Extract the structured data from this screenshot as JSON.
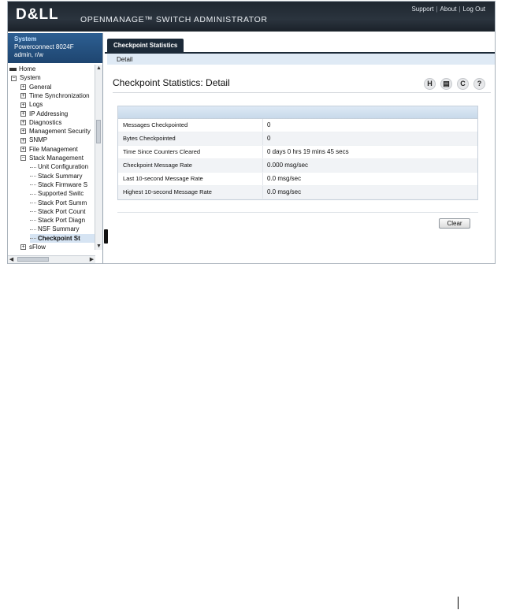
{
  "header": {
    "logo": "D&LL",
    "app_title": "OPENMANAGE™ SWITCH ADMINISTRATOR",
    "links": [
      "Support",
      "About",
      "Log Out"
    ]
  },
  "system": {
    "heading": "System",
    "device": "Powerconnect 8024F",
    "user": "admin, r/w"
  },
  "tree": [
    {
      "label": "Home",
      "kind": "icon"
    },
    {
      "label": "System",
      "kind": "minus"
    },
    {
      "label": "General",
      "kind": "plus"
    },
    {
      "label": "Time Synchronization",
      "kind": "plus"
    },
    {
      "label": "Logs",
      "kind": "plus"
    },
    {
      "label": "IP Addressing",
      "kind": "plus"
    },
    {
      "label": "Diagnostics",
      "kind": "plus"
    },
    {
      "label": "Management Security",
      "kind": "plus"
    },
    {
      "label": "SNMP",
      "kind": "plus"
    },
    {
      "label": "File Management",
      "kind": "plus"
    },
    {
      "label": "Stack Management",
      "kind": "minus"
    },
    {
      "label": "Unit Configuration",
      "kind": "leaf"
    },
    {
      "label": "Stack Summary",
      "kind": "leaf"
    },
    {
      "label": "Stack Firmware S",
      "kind": "leaf"
    },
    {
      "label": "Supported Switc",
      "kind": "leaf"
    },
    {
      "label": "Stack Port Summ",
      "kind": "leaf"
    },
    {
      "label": "Stack Port Count",
      "kind": "leaf"
    },
    {
      "label": "Stack Port Diagn",
      "kind": "leaf"
    },
    {
      "label": "NSF Summary",
      "kind": "leaf"
    },
    {
      "label": "Checkpoint St",
      "kind": "leaf",
      "selected": true
    },
    {
      "label": "sFlow",
      "kind": "plus"
    }
  ],
  "tab": {
    "label": "Checkpoint Statistics",
    "subnav": "Detail"
  },
  "page": {
    "title": "Checkpoint Statistics: Detail",
    "icons": [
      "save-icon",
      "print-icon",
      "refresh-icon",
      "help-icon"
    ]
  },
  "table": {
    "rows": [
      {
        "key": "Messages Checkpointed",
        "value": "0"
      },
      {
        "key": "Bytes Checkpointed",
        "value": "0"
      },
      {
        "key": "Time Since Counters Cleared",
        "value": "0 days 0 hrs 19 mins 45 secs"
      },
      {
        "key": "Checkpoint Message Rate",
        "value": "0.000 msg/sec"
      },
      {
        "key": "Last 10-second Message Rate",
        "value": "0.0 msg/sec"
      },
      {
        "key": "Highest 10-second Message Rate",
        "value": "0.0 msg/sec"
      }
    ]
  },
  "actions": {
    "clear_label": "Clear"
  }
}
